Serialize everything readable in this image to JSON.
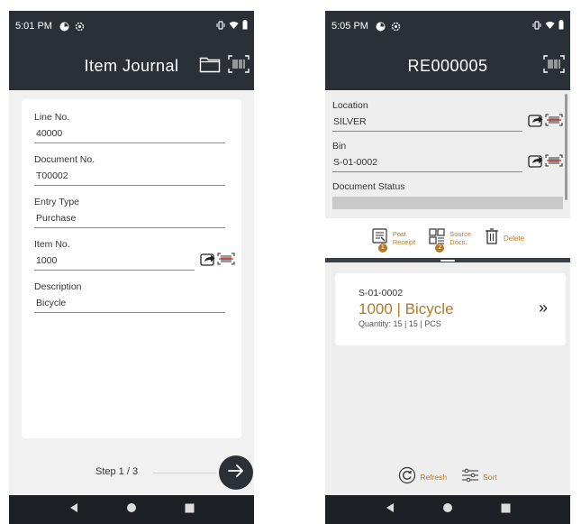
{
  "left_screen": {
    "status_time": "5:01 PM",
    "title": "Item Journal",
    "fields": [
      {
        "label": "Line No.",
        "value": "40000"
      },
      {
        "label": "Document No.",
        "value": "T00002"
      },
      {
        "label": "Entry Type",
        "value": "Purchase"
      },
      {
        "label": "Item No.",
        "value": "1000"
      },
      {
        "label": "Description",
        "value": "Bicycle"
      }
    ],
    "step": "Step  1 / 3"
  },
  "right_screen": {
    "status_time": "5:05 PM",
    "title": "RE000005",
    "location_label": "Location",
    "location_value": "SILVER",
    "bin_label": "Bin",
    "bin_value": "S-01-0002",
    "doc_status_label": "Document Status",
    "actions": {
      "post_line1": "Post",
      "post_line2": "Receipt",
      "post_badge": "1",
      "source_line1": "Source",
      "source_line2": "Docs.",
      "source_badge": "2",
      "delete": "Delete"
    },
    "card": {
      "bin": "S-01-0002",
      "title": "1000 | Bicycle",
      "quantity": "Quantity: 15 | 15 | PCS",
      "chevron": "»"
    },
    "toolbar": {
      "refresh": "Refresh",
      "sort": "Sort"
    }
  },
  "colors": {
    "header": "#2b3037",
    "accent": "#b07a2a",
    "barcode_red": "#d02020"
  },
  "icons": [
    "folder-icon",
    "barcode-scan-icon",
    "share-icon",
    "barcode-icon",
    "chevron-double-right-icon",
    "refresh-icon",
    "sort-icon",
    "trash-icon",
    "post-receipt-icon",
    "source-docs-icon",
    "arrow-right-icon"
  ]
}
